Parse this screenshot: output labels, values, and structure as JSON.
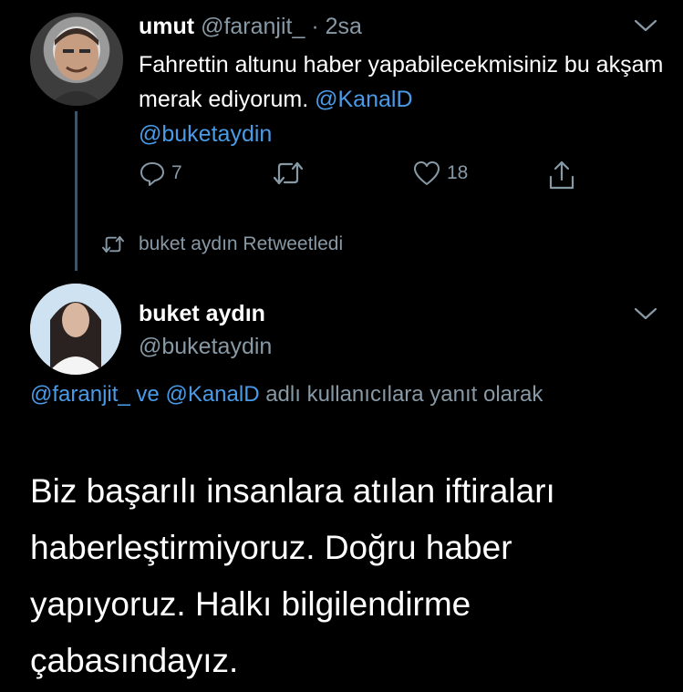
{
  "tweet1": {
    "display_name": "umut",
    "handle": "@faranjit_",
    "separator": "·",
    "time": "2sa",
    "text_plain": "Fahrettin altunu haber yapabilecekmisiniz bu akşam merak ediyorum. ",
    "mention1": "@KanalD",
    "mention2": "@buketaydin",
    "reply_count": "7",
    "retweet_count": "",
    "like_count": "18"
  },
  "retweet_label": "buket aydın Retweetledi",
  "tweet2": {
    "display_name": "buket aydın",
    "handle": "@buketaydin",
    "reply_mention1": "@faranjit_",
    "reply_joiner": "ve",
    "reply_mention2": "@KanalD",
    "reply_suffix": "adlı kullanıcılara yanıt olarak",
    "text": "Biz başarılı insanlara atılan iftiraları haberleştirmiyoruz. Doğru haber yapıyoruz. Halkı bilgilendirme çabasındayız."
  },
  "icons": {
    "reply": "reply-icon",
    "retweet": "retweet-icon",
    "like": "heart-icon",
    "share": "share-icon",
    "caret": "chevron-down-icon"
  },
  "colors": {
    "background": "#000000",
    "text": "#ffffff",
    "muted": "#8899a6",
    "link": "#4a9be7",
    "thread_line": "#3d5466"
  }
}
